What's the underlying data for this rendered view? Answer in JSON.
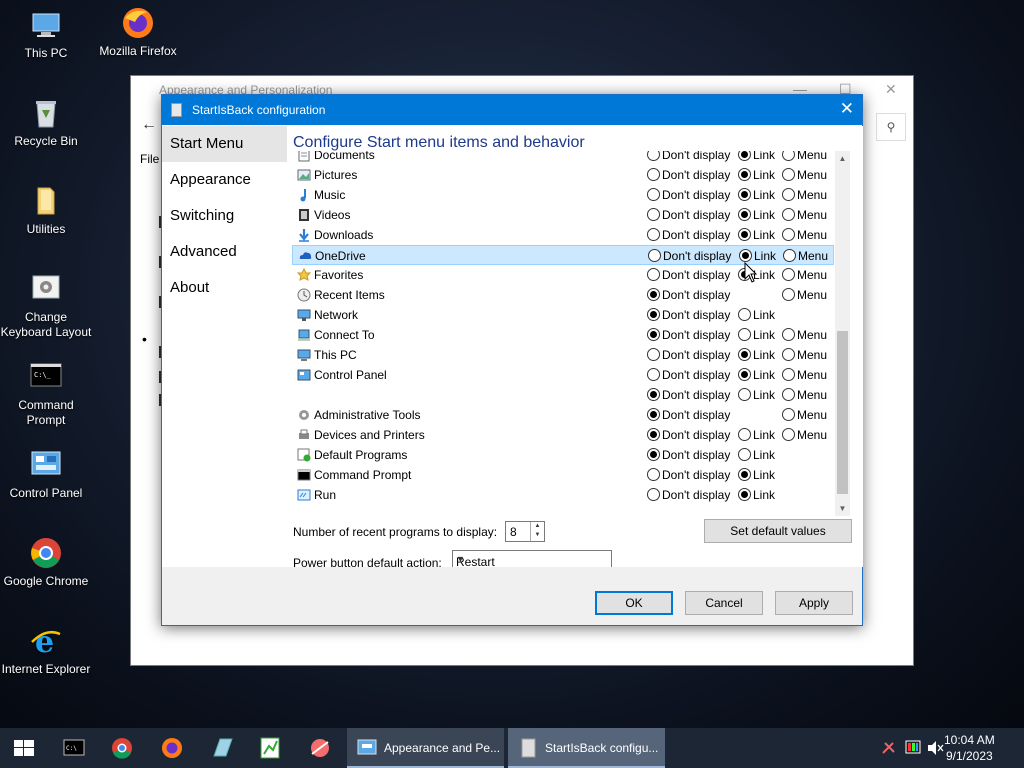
{
  "desktop": {
    "icons": [
      {
        "label": "This PC"
      },
      {
        "label": "Mozilla Firefox"
      },
      {
        "label": "Recycle Bin"
      },
      {
        "label": "Utilities"
      },
      {
        "label": "Change Keyboard Layout"
      },
      {
        "label": "Command Prompt"
      },
      {
        "label": "Control Panel"
      },
      {
        "label": "Google Chrome"
      },
      {
        "label": "Internet Explorer"
      }
    ]
  },
  "background_window": {
    "title": "Appearance and Personalization",
    "menu_file": "File"
  },
  "dialog": {
    "title": "StartIsBack configuration",
    "close": "✕",
    "nav": [
      {
        "label": "Start Menu",
        "active": true
      },
      {
        "label": "Appearance"
      },
      {
        "label": "Switching"
      },
      {
        "label": "Advanced"
      },
      {
        "label": "About"
      }
    ],
    "heading": "Configure Start menu items and behavior",
    "options": {
      "dont": "Don't display",
      "link": "Link",
      "menu": "Menu"
    },
    "items": [
      {
        "label": "Documents",
        "icon": "documents-icon",
        "choices": [
          "dont",
          "link",
          "menu"
        ],
        "selected": "link"
      },
      {
        "label": "Pictures",
        "icon": "pictures-icon",
        "choices": [
          "dont",
          "link",
          "menu"
        ],
        "selected": "link"
      },
      {
        "label": "Music",
        "icon": "music-icon",
        "choices": [
          "dont",
          "link",
          "menu"
        ],
        "selected": "link"
      },
      {
        "label": "Videos",
        "icon": "videos-icon",
        "choices": [
          "dont",
          "link",
          "menu"
        ],
        "selected": "link"
      },
      {
        "label": "Downloads",
        "icon": "downloads-icon",
        "choices": [
          "dont",
          "link",
          "menu"
        ],
        "selected": "link"
      },
      {
        "label": "OneDrive",
        "icon": "onedrive-icon",
        "choices": [
          "dont",
          "link",
          "menu"
        ],
        "selected": "link",
        "highlighted": true
      },
      {
        "label": "Favorites",
        "icon": "favorites-icon",
        "choices": [
          "dont",
          "link",
          "menu"
        ],
        "selected": "link"
      },
      {
        "label": "Recent Items",
        "icon": "recent-items-icon",
        "choices": [
          "dont",
          "menu"
        ],
        "selected": "dont"
      },
      {
        "label": "Network",
        "icon": "network-icon",
        "choices": [
          "dont",
          "link"
        ],
        "selected": "dont"
      },
      {
        "label": "Connect To",
        "icon": "connect-to-icon",
        "choices": [
          "dont",
          "link",
          "menu"
        ],
        "selected": "dont"
      },
      {
        "label": "This PC",
        "icon": "this-pc-icon",
        "choices": [
          "dont",
          "link",
          "menu"
        ],
        "selected": "link"
      },
      {
        "label": "Control Panel",
        "icon": "control-panel-icon",
        "choices": [
          "dont",
          "link",
          "menu"
        ],
        "selected": "link"
      },
      {
        "label": "",
        "icon": "",
        "choices": [
          "dont",
          "link",
          "menu"
        ],
        "selected": "dont"
      },
      {
        "label": "Administrative Tools",
        "icon": "administrative-tools-icon",
        "choices": [
          "dont",
          "menu"
        ],
        "selected": "dont"
      },
      {
        "label": "Devices and Printers",
        "icon": "devices-printers-icon",
        "choices": [
          "dont",
          "link",
          "menu"
        ],
        "selected": "dont"
      },
      {
        "label": "Default Programs",
        "icon": "default-programs-icon",
        "choices": [
          "dont",
          "link"
        ],
        "selected": "dont"
      },
      {
        "label": "Command Prompt",
        "icon": "command-prompt-icon",
        "choices": [
          "dont",
          "link"
        ],
        "selected": "link"
      },
      {
        "label": "Run",
        "icon": "run-icon",
        "choices": [
          "dont",
          "link"
        ],
        "selected": "link"
      }
    ],
    "recent_label": "Number of recent programs to display:",
    "recent_value": "8",
    "default_values_button": "Set default values",
    "power_label": "Power button default action:",
    "power_value": "Restart",
    "buttons": {
      "ok": "OK",
      "cancel": "Cancel",
      "apply": "Apply"
    }
  },
  "taskbar": {
    "tasks": [
      {
        "label": "Appearance and Pe..."
      },
      {
        "label": "StartIsBack configu..."
      }
    ],
    "time": "10:04 AM",
    "date": "9/1/2023"
  },
  "colors": {
    "accent": "#0078d7",
    "heading": "#1e3a8a",
    "selection": "#cce8ff"
  }
}
